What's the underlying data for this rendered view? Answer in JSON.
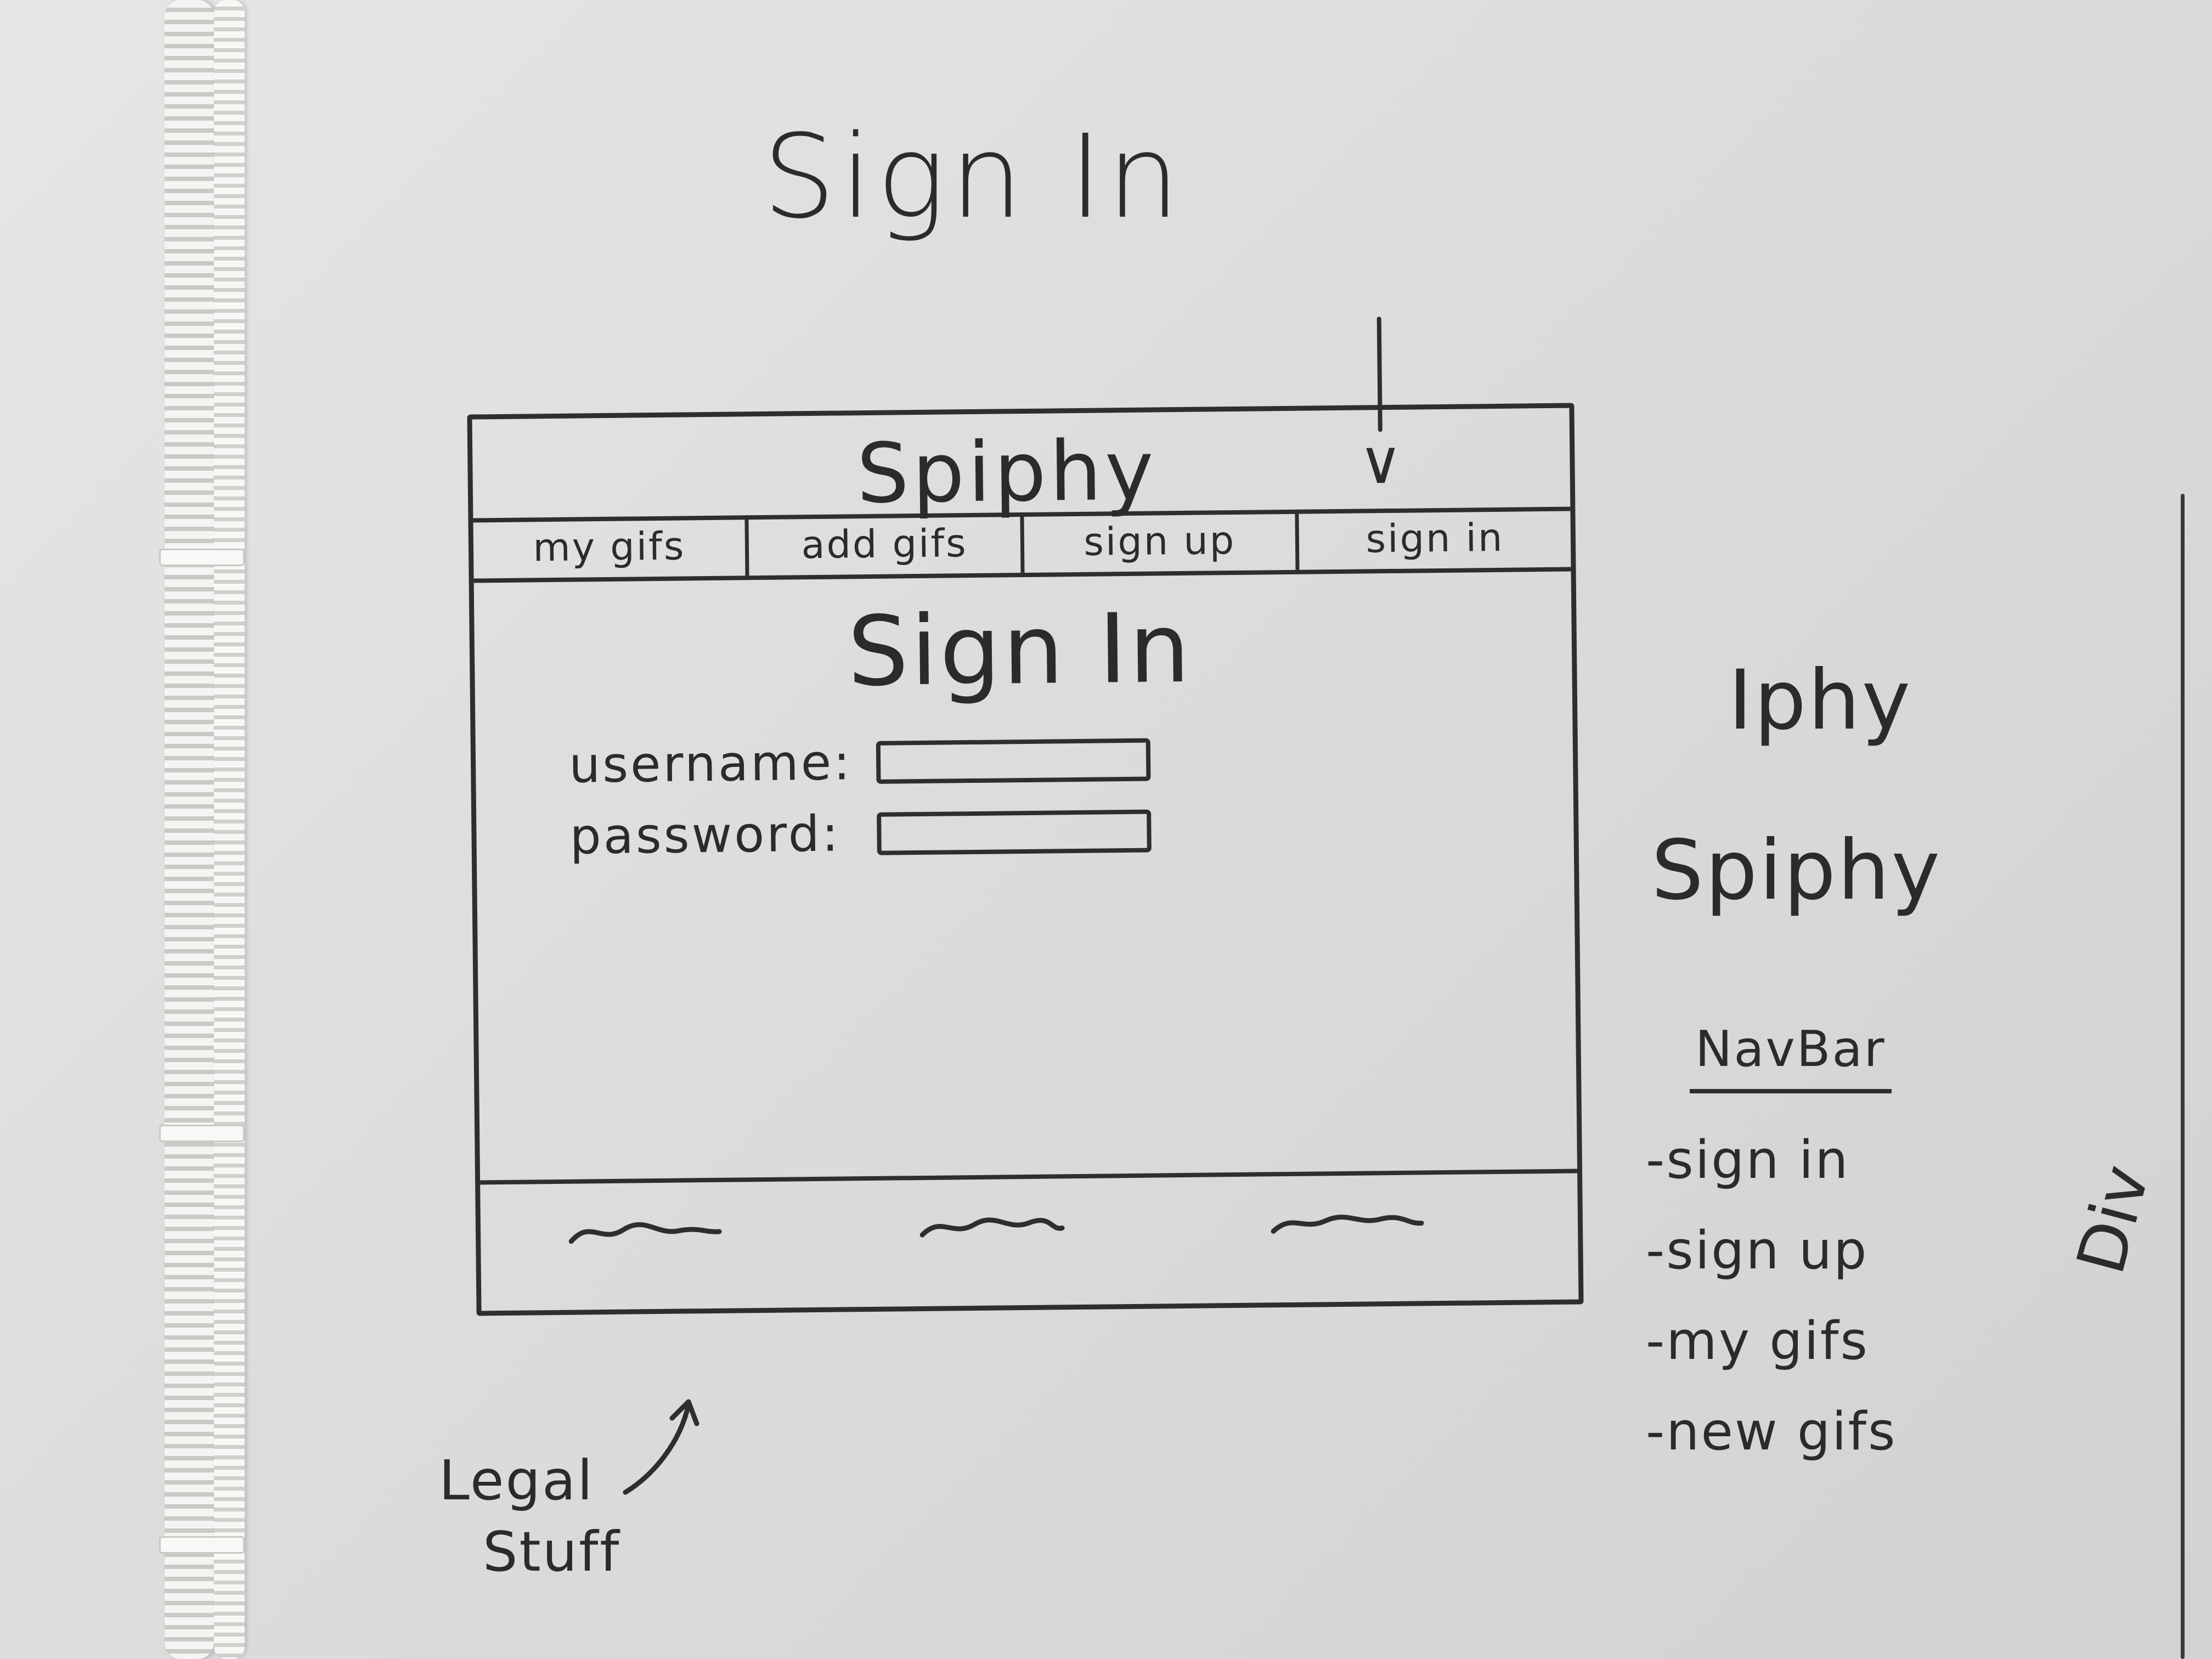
{
  "whiteboard": {
    "title": "Sign In"
  },
  "mockup": {
    "brand": "Spiphy",
    "dropdown_icon": "chevron-down-icon",
    "nav": [
      {
        "label": "my gifs"
      },
      {
        "label": "add gifs"
      },
      {
        "label": "sign up"
      },
      {
        "label": "sign in"
      }
    ],
    "page_heading": "Sign In",
    "form": {
      "username_label": "username:",
      "password_label": "password:",
      "username_value": "",
      "password_value": ""
    },
    "footer_icons": [
      "squiggle-icon",
      "squiggle-icon",
      "squiggle-icon"
    ]
  },
  "annotations": {
    "legal_line1": "Legal",
    "legal_line2": "Stuff",
    "name_idea_1": "Iphy",
    "name_idea_2": "Spiphy",
    "navbar_heading": "NavBar",
    "navbar_items": [
      "-sign in",
      "-sign up",
      "-my gifs",
      "-new gifs"
    ],
    "div_label": "Div"
  }
}
